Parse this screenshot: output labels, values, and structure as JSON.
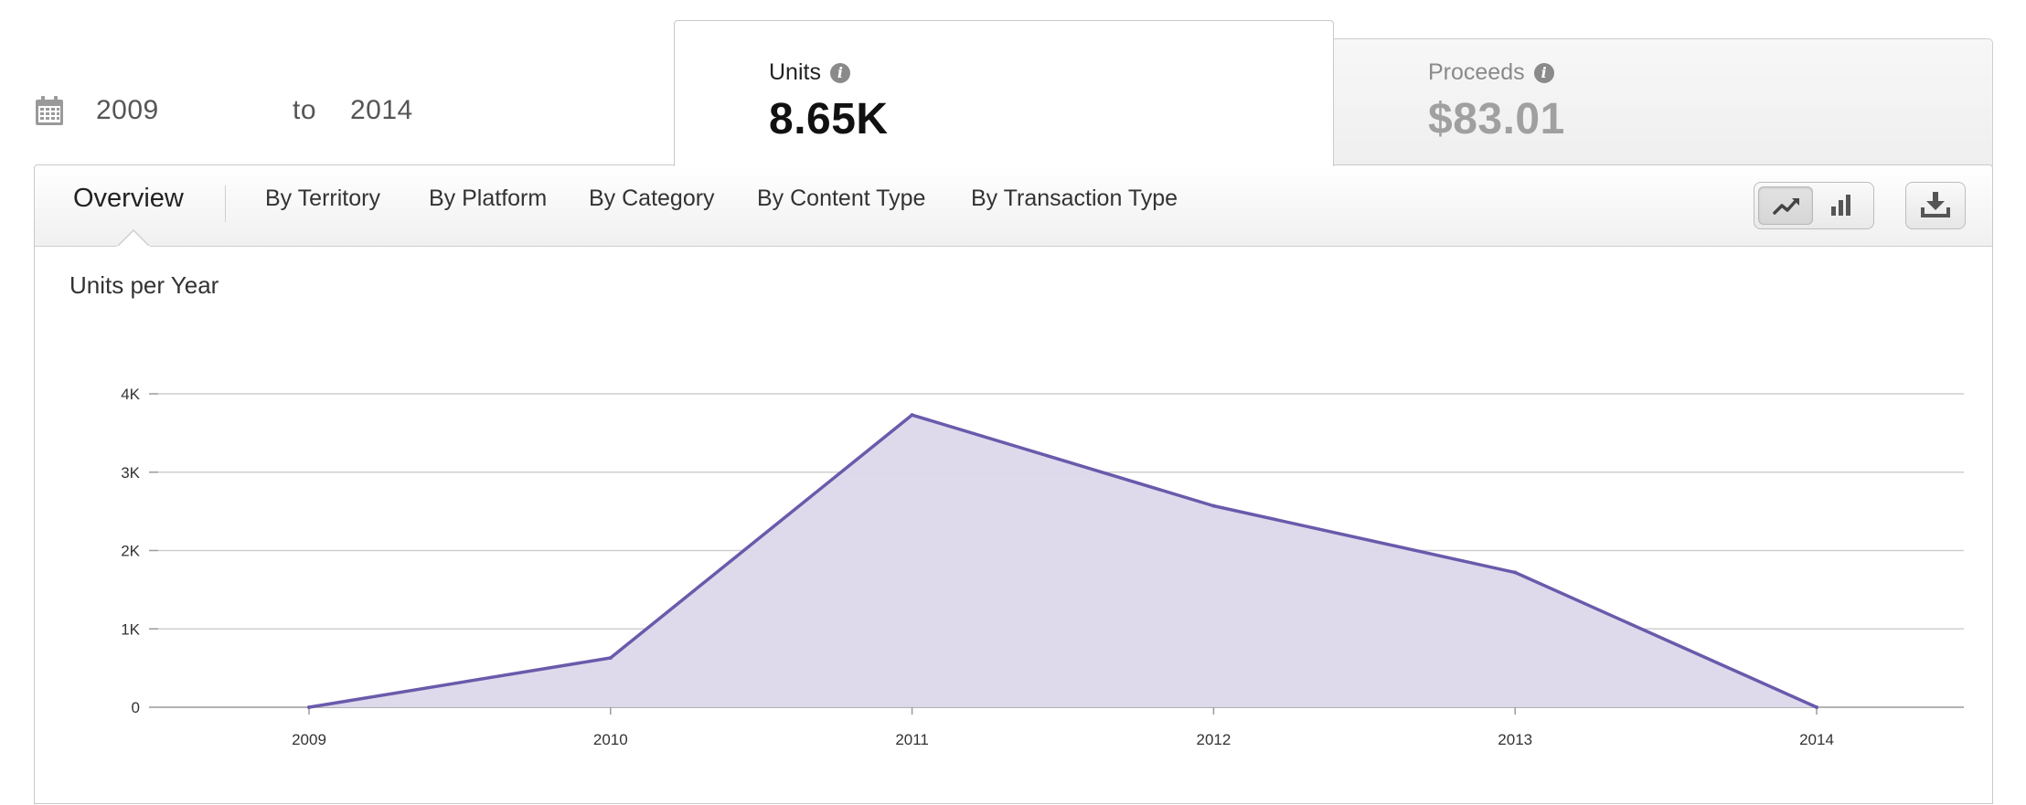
{
  "date_range": {
    "from": "2009",
    "separator": "to",
    "to": "2014"
  },
  "metrics": {
    "units": {
      "label": "Units",
      "value": "8.65K"
    },
    "proceeds": {
      "label": "Proceeds",
      "value": "$83.01"
    }
  },
  "nav": {
    "active": "Overview",
    "items": [
      "By Territory",
      "By Platform",
      "By Category",
      "By Content Type",
      "By Transaction Type"
    ]
  },
  "icons": {
    "date": "calendar-icon",
    "info": "info-icon",
    "line_chart": "line-chart-icon",
    "bar_chart": "bar-chart-icon",
    "download": "download-icon"
  },
  "colors": {
    "series_line": "#6a5aab",
    "series_fill": "#dcd8eb",
    "grid": "#cfcfcf",
    "info_icon": "#8a8a8a",
    "units_value": "#111111",
    "proceeds_value": "#a0a0a0",
    "proceeds_label": "#8a8a8a"
  },
  "chart_data": {
    "type": "area",
    "title": "Units per Year",
    "xlabel": "",
    "ylabel": "",
    "x": [
      "2009",
      "2010",
      "2011",
      "2012",
      "2013",
      "2014"
    ],
    "series": [
      {
        "values": [
          0,
          630,
          3730,
          2570,
          1720,
          0
        ]
      }
    ],
    "ylim": [
      0,
      4000
    ],
    "yticks": [
      0,
      1000,
      2000,
      3000,
      4000
    ],
    "ytick_labels": [
      "0",
      "1K",
      "2K",
      "3K",
      "4K"
    ],
    "grid": true,
    "legend": "none"
  }
}
